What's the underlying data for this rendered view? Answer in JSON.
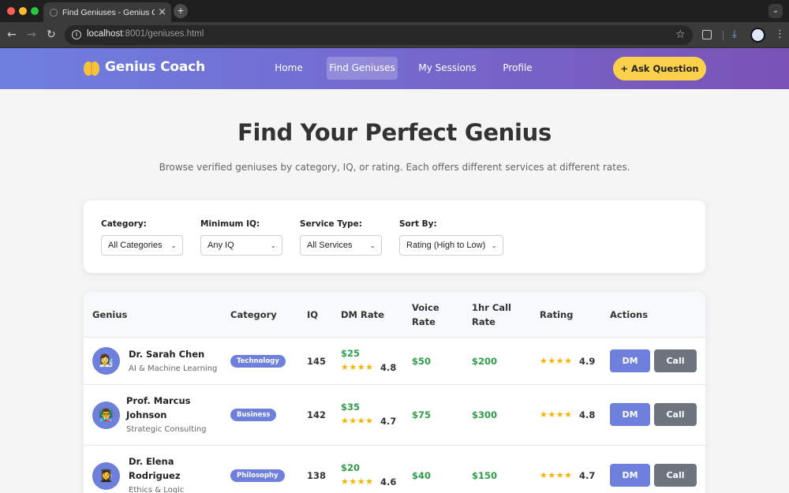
{
  "browser": {
    "tab_title": "Find Geniuses - Genius Coach",
    "tab_close": "×",
    "new_tab": "+",
    "url_host": "localhost",
    "url_rest": ":8001/geniuses.html"
  },
  "header": {
    "logo_text": "Genius Coach",
    "nav": [
      {
        "label": "Home"
      },
      {
        "label": "Find Geniuses"
      },
      {
        "label": "My Sessions"
      },
      {
        "label": "Profile"
      }
    ],
    "ask_button": "+ Ask Question",
    "colors": {
      "gradient_start": "#6e7fe0",
      "gradient_end": "#7a52b5",
      "accent": "#fbd04a"
    }
  },
  "page": {
    "title": "Find Your Perfect Genius",
    "subtitle": "Browse verified geniuses by category, IQ, or rating. Each offers different services at different rates."
  },
  "filters": [
    {
      "label": "Category:",
      "value": "All Categories"
    },
    {
      "label": "Minimum IQ:",
      "value": "Any IQ"
    },
    {
      "label": "Service Type:",
      "value": "All Services"
    },
    {
      "label": "Sort By:",
      "value": "Rating (High to Low)"
    }
  ],
  "table": {
    "headers": {
      "genius": "Genius",
      "category": "Category",
      "iq": "IQ",
      "dm_rate": "DM Rate",
      "voice_rate_1": "Voice",
      "voice_rate_2": "Rate",
      "call_rate_1": "1hr Call",
      "call_rate_2": "Rate",
      "rating": "Rating",
      "actions": "Actions"
    },
    "rows": [
      {
        "name_1": "Dr. Sarah Chen",
        "name_2": "",
        "specialty": "AI & Machine Learning",
        "avatar": "👩‍🔬",
        "category": "Technology",
        "iq": "145",
        "dm_rate": "$25",
        "dm_stars": "★★★★",
        "dm_rating": "4.8",
        "voice_rate": "$50",
        "call_rate": "$200",
        "stars": "★★★★",
        "rating": "4.9",
        "dm_label": "DM",
        "call_label": "Call"
      },
      {
        "name_1": "Prof. Marcus",
        "name_2": "Johnson",
        "specialty": "Strategic Consulting",
        "avatar": "👨‍🏫",
        "category": "Business",
        "iq": "142",
        "dm_rate": "$35",
        "dm_stars": "★★★★",
        "dm_rating": "4.7",
        "voice_rate": "$75",
        "call_rate": "$300",
        "stars": "★★★★",
        "rating": "4.8",
        "dm_label": "DM",
        "call_label": "Call"
      },
      {
        "name_1": "Dr. Elena",
        "name_2": "Rodriguez",
        "specialty": "Ethics & Logic",
        "avatar": "👩‍🎓",
        "category": "Philosophy",
        "iq": "138",
        "dm_rate": "$20",
        "dm_stars": "★★★★",
        "dm_rating": "4.6",
        "voice_rate": "$40",
        "call_rate": "$150",
        "stars": "★★★★",
        "rating": "4.7",
        "dm_label": "DM",
        "call_label": "Call"
      }
    ]
  }
}
